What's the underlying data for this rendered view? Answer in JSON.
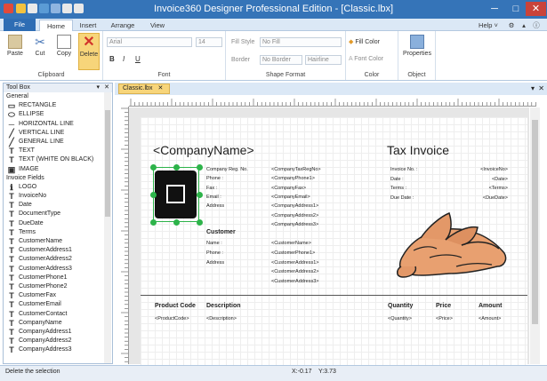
{
  "window": {
    "title": "Invoice360 Designer Professional Edition - [Classic.lbx]",
    "minimize": "─",
    "maximize": "□",
    "close": "✕"
  },
  "tabs": [
    "File",
    "Home",
    "Insert",
    "Arrange",
    "View"
  ],
  "help": "Help ˅",
  "ribbon": {
    "clipboard": {
      "label": "Clipboard",
      "paste": "Paste",
      "cut": "Cut",
      "copy": "Copy",
      "delete": "Delete"
    },
    "font": {
      "label": "Font",
      "font_name": "Arial",
      "font_size": "14",
      "bold": "B",
      "italic": "I",
      "underline": "U"
    },
    "shape": {
      "label": "Shape Format",
      "fill_style_cap": "Fill Style",
      "fill_style": "No Fill",
      "border_cap": "Border",
      "border": "No Border",
      "border_style": "Hairline"
    },
    "color": {
      "label": "Color",
      "fill_color": "Fill Color",
      "font_color": "Font Color"
    },
    "object": {
      "label": "Object",
      "properties": "Properties"
    }
  },
  "toolbox": {
    "title": "Tool Box",
    "items": [
      {
        "type": "header",
        "label": "General"
      },
      {
        "icon": "▭",
        "label": "RECTANGLE"
      },
      {
        "icon": "⬭",
        "label": "ELLIPSE"
      },
      {
        "icon": "─",
        "label": "HORIZONTAL LINE"
      },
      {
        "icon": "╱",
        "label": "VERTICAL LINE"
      },
      {
        "icon": "╱",
        "label": "GENERAL LINE"
      },
      {
        "icon": "T",
        "label": "TEXT"
      },
      {
        "icon": "T",
        "label": "TEXT (WHITE ON BLACK)"
      },
      {
        "icon": "▣",
        "label": "IMAGE"
      },
      {
        "type": "header",
        "label": "Invoice Fields"
      },
      {
        "icon": "ℹ",
        "label": "LOGO"
      },
      {
        "icon": "T",
        "label": "InvoiceNo"
      },
      {
        "icon": "T",
        "label": "Date"
      },
      {
        "icon": "T",
        "label": "DocumentType"
      },
      {
        "icon": "T",
        "label": "DueDate"
      },
      {
        "icon": "T",
        "label": "Terms"
      },
      {
        "icon": "T",
        "label": "CustomerName"
      },
      {
        "icon": "T",
        "label": "CustomerAddress1"
      },
      {
        "icon": "T",
        "label": "CustomerAddress2"
      },
      {
        "icon": "T",
        "label": "CustomerAddress3"
      },
      {
        "icon": "T",
        "label": "CustomerPhone1"
      },
      {
        "icon": "T",
        "label": "CustomerPhone2"
      },
      {
        "icon": "T",
        "label": "CustomerFax"
      },
      {
        "icon": "T",
        "label": "CustomerEmail"
      },
      {
        "icon": "T",
        "label": "CustomerContact"
      },
      {
        "icon": "T",
        "label": "CompanyName"
      },
      {
        "icon": "T",
        "label": "CompanyAddress1"
      },
      {
        "icon": "T",
        "label": "CompanyAddress2"
      },
      {
        "icon": "T",
        "label": "CompanyAddress3"
      }
    ]
  },
  "document": {
    "tab": "Classic.lbx",
    "company_name": "<CompanyName>",
    "tax_invoice": "Tax Invoice",
    "company_labels": [
      "Company Reg. No.",
      "Phone :",
      "Fax :",
      "Email :",
      "Address"
    ],
    "company_values": [
      "<CompanyTaxRegNo>",
      "<CompanyPhone1>",
      "<CompanyFax>",
      "<CompanyEmail>",
      "<CompanyAddress1>",
      "<CompanyAddress2>",
      "<CompanyAddress3>"
    ],
    "invoice_labels": [
      "Invoice No. :",
      "Date :",
      "Terms :",
      "Due Date :"
    ],
    "invoice_values": [
      "<InvoiceNo>",
      "<Date>",
      "<Terms>",
      "<DueDate>"
    ],
    "customer_heading": "Customer",
    "customer_labels": [
      "Name :",
      "Phone :",
      "Address"
    ],
    "customer_values": [
      "<CustomerName>",
      "<CustomerPhone1>",
      "<CustomerAddress1>",
      "<CustomerAddress2>",
      "<CustomerAddress3>"
    ],
    "columns": [
      "Product Code",
      "Description",
      "Quantity",
      "Price",
      "Amount"
    ],
    "column_values": [
      "<ProductCode>",
      "<Description>",
      "<Quantity>",
      "<Price>",
      "<Amount>"
    ]
  },
  "status": {
    "message": "Delete the selection",
    "x": "X:-0.17",
    "y": "Y:3.73"
  }
}
